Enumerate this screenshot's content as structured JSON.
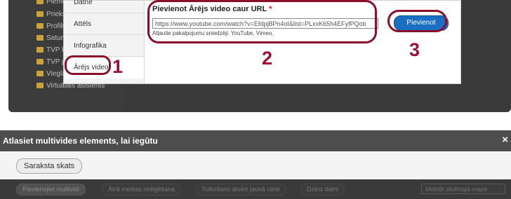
{
  "tree": {
    "items": [
      "Piemē",
      "Priekš",
      "Profilu",
      "Satura",
      "TVP b",
      "TVP p",
      "Vieglā valoda",
      "Virtuālais asistents"
    ]
  },
  "dialog": {
    "tabs": [
      "Datne",
      "Attēls",
      "Infografika",
      "Ārējs video"
    ],
    "url_label": "Pievienot Ārējs video caur URL",
    "required_mark": "*",
    "url_value": "https://www.youtube.com/watch?v=EfdpjBPn4oI&list=PLxxK65h4EFyfPQob",
    "hint": "Atļautie pakalpojumu sniedzēji: YouTube, Vimeo.",
    "add_button": "Pievienot"
  },
  "steps": [
    "1",
    "2",
    "3"
  ],
  "modal": {
    "title": "Atlasiet multivides elements, lai iegūtu",
    "close": "×",
    "list_view_button": "Saraksta skats",
    "toolbar": {
      "add_media": "Pievienojiet multividi",
      "quick_edit": "Ātrā medias rediģēšana",
      "open_new_tab": "Tulkošanu atvērt jaunā cilnē",
      "delete": "Dzēst datni",
      "search_placeholder": "Meklēt atvērtajā mapē"
    }
  },
  "colors": {
    "highlight_ring": "#8a0f2a",
    "step_number": "#9b1030",
    "primary_button": "#1a6fc2"
  }
}
